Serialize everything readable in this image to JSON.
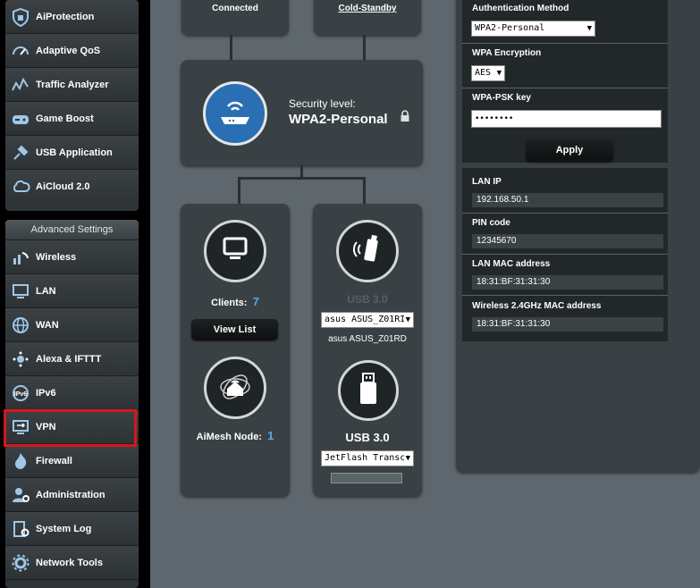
{
  "sidebar": {
    "items_top": [
      {
        "label": "AiProtection",
        "icon": "shield-icon"
      },
      {
        "label": "Adaptive QoS",
        "icon": "speedometer-icon"
      },
      {
        "label": "Traffic Analyzer",
        "icon": "pulse-chart-icon"
      },
      {
        "label": "Game Boost",
        "icon": "gamepad-icon"
      },
      {
        "label": "USB Application",
        "icon": "usb-plug-icon"
      },
      {
        "label": "AiCloud 2.0",
        "icon": "cloud-icon"
      }
    ],
    "advanced_header": "Advanced Settings",
    "items_advanced": [
      {
        "label": "Wireless",
        "icon": "wifi-signal-icon"
      },
      {
        "label": "LAN",
        "icon": "monitor-network-icon"
      },
      {
        "label": "WAN",
        "icon": "globe-icon"
      },
      {
        "label": "Alexa & IFTTT",
        "icon": "alexa-icon"
      },
      {
        "label": "IPv6",
        "icon": "ipv6-icon"
      },
      {
        "label": "VPN",
        "icon": "vpn-monitor-icon"
      },
      {
        "label": "Firewall",
        "icon": "flame-icon"
      },
      {
        "label": "Administration",
        "icon": "gear-person-icon"
      },
      {
        "label": "System Log",
        "icon": "log-gear-icon"
      },
      {
        "label": "Network Tools",
        "icon": "tools-gear-icon"
      }
    ],
    "highlighted": "VPN"
  },
  "map": {
    "top_left_status": "Connected",
    "top_right_status": "Cold-Standby",
    "router": {
      "security_label": "Security level:",
      "security_value": "WPA2-Personal"
    },
    "clients": {
      "label": "Clients:",
      "count": "7",
      "view_list_button": "View List"
    },
    "aimesh": {
      "label": "AiMesh Node:",
      "count": "1"
    },
    "usb1": {
      "title": "USB 3.0",
      "device_select": "asus ASUS_Z01RI",
      "device_name": "asus ASUS_Z01RD"
    },
    "usb2": {
      "title": "USB 3.0",
      "device_select": "JetFlash Transc"
    }
  },
  "wireless_panel": {
    "auth_label": "Authentication Method",
    "auth_value": "WPA2-Personal",
    "enc_label": "WPA Encryption",
    "enc_value": "AES",
    "psk_label": "WPA-PSK key",
    "psk_value": "••••••••",
    "apply_button": "Apply"
  },
  "lan_panel": {
    "lan_ip_label": "LAN IP",
    "lan_ip_value": "192.168.50.1",
    "pin_label": "PIN code",
    "pin_value": "12345670",
    "lan_mac_label": "LAN MAC address",
    "lan_mac_value": "18:31:BF:31:31:30",
    "wmac_label": "Wireless 2.4GHz MAC address",
    "wmac_value": "18:31:BF:31:31:30"
  },
  "colors": {
    "accent_count": "#5aa9e6",
    "highlight_border": "#d7161d",
    "background": "#5d676d"
  }
}
